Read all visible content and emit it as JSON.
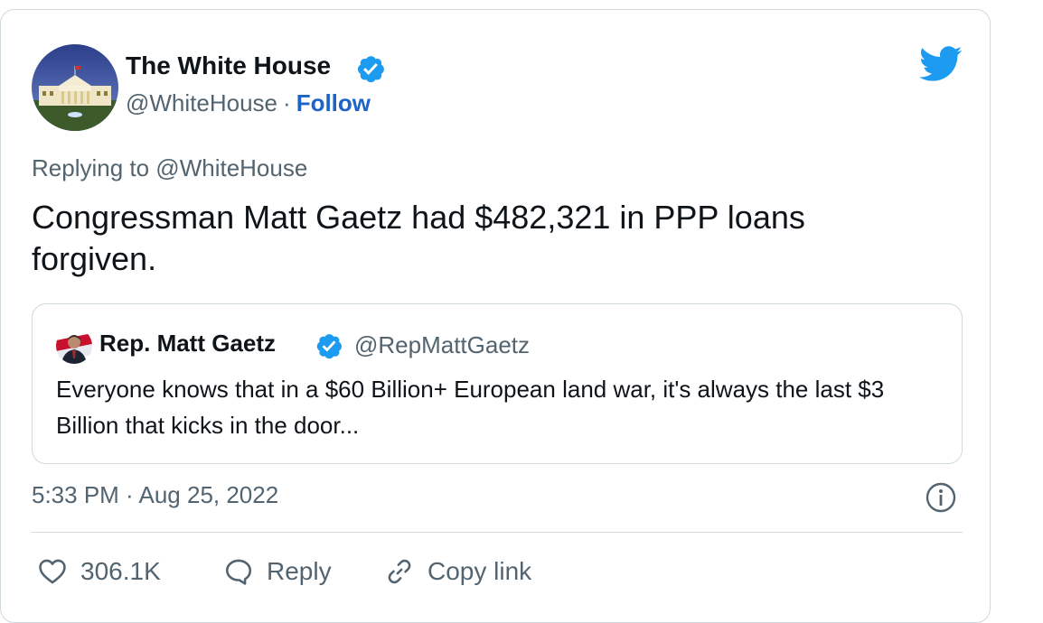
{
  "tweet": {
    "author_name": "The White House",
    "author_handle": "@WhiteHouse",
    "separator": "·",
    "follow_label": "Follow",
    "replying_to": "Replying to @WhiteHouse",
    "text": "Congressman Matt Gaetz had $482,321 in PPP loans forgiven.",
    "timestamp": "5:33 PM · Aug 25, 2022"
  },
  "quoted_tweet": {
    "author_name": "Rep. Matt Gaetz",
    "author_handle": "@RepMattGaetz",
    "text": "Everyone knows that in a $60 Billion+ European land war, it's always the last $3 Billion that kicks in the door..."
  },
  "actions": {
    "like_count": "306.1K",
    "reply_label": "Reply",
    "copy_link_label": "Copy link"
  },
  "colors": {
    "verified_blue": "#1d9bf0",
    "twitter_blue": "#1d9bf0",
    "follow_link": "#1d64c8",
    "secondary_text": "#536471",
    "border": "#cfd9de"
  },
  "icons": {
    "verified": "verified-badge-icon",
    "brand": "twitter-bird-icon",
    "info": "info-icon",
    "like": "heart-icon",
    "reply": "speech-bubble-icon",
    "copy_link": "link-icon"
  }
}
